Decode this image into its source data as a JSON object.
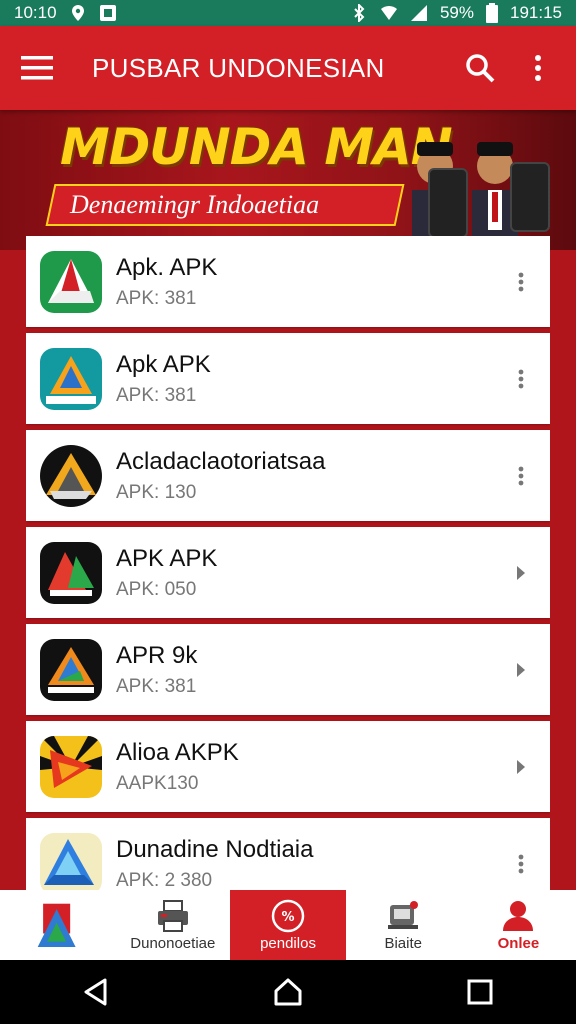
{
  "status_bar": {
    "time": "10:10",
    "battery": "59%",
    "clock_right": "191:15"
  },
  "app_bar": {
    "title": "PUSBAR UNDONESIAN"
  },
  "banner": {
    "headline": "MDUNDA MAN",
    "subtitle": "Denaemingr Indoaetiaa"
  },
  "apps": [
    {
      "name": "Apk. APK",
      "sub": "APK: 381",
      "icon": "triangle-logo-green"
    },
    {
      "name": "Apk APK",
      "sub": "APK: 381",
      "icon": "triangle-logo-teal"
    },
    {
      "name": "Acladaclaotoriatsaa",
      "sub": "APK: 130",
      "icon": "triangle-logo-gold"
    },
    {
      "name": "APK APK",
      "sub": "APK: 050",
      "icon": "triangle-logo-black"
    },
    {
      "name": "APR 9k",
      "sub": "APK: 381",
      "icon": "triangle-logo-dark"
    },
    {
      "name": "Alioa AKPK",
      "sub": "AAPK130",
      "icon": "triangle-logo-sunburst"
    },
    {
      "name": "Dunadine Nodtiaia",
      "sub": "APK: 2 380",
      "icon": "triangle-logo-blue"
    }
  ],
  "bottom_nav": [
    {
      "label": "",
      "icon": "home-logo-icon"
    },
    {
      "label": "Dunonoetiae",
      "icon": "printer-icon"
    },
    {
      "label": "pendilos",
      "icon": "sale-icon"
    },
    {
      "label": "Biaite",
      "icon": "scanner-icon"
    },
    {
      "label": "Onlee",
      "icon": "person-icon"
    }
  ],
  "colors": {
    "primary": "#d32027",
    "status_bar": "#1a7a5c",
    "banner_text": "#ffd21a"
  }
}
